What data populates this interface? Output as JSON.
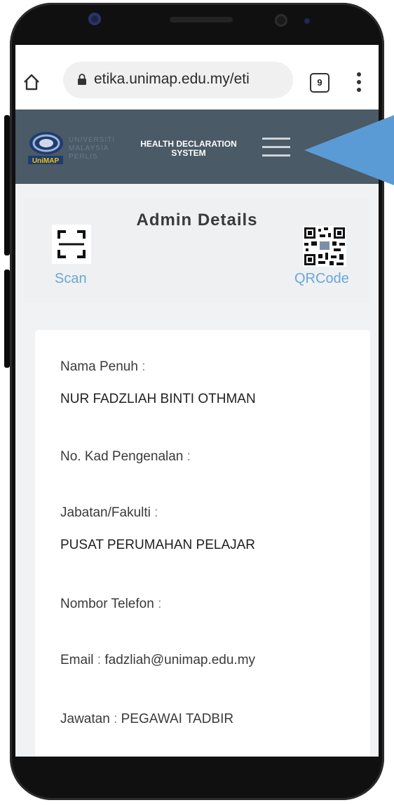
{
  "browser": {
    "url": "etika.unimap.edu.my/eti",
    "tab_count": "9"
  },
  "header": {
    "logo_text_lines": [
      "UNIVERSITI",
      "MALAYSIA",
      "PERLIS"
    ],
    "system_title_line1": "HEALTH DECLARATION",
    "system_title_line2": "SYSTEM"
  },
  "admin": {
    "title": "Admin Details",
    "scan_label": "Scan",
    "qrcode_label": "QRCode"
  },
  "details": {
    "full_name_label": "Nama Penuh",
    "full_name_value": "NUR FADZLIAH BINTI OTHMAN",
    "ic_label": "No. Kad Pengenalan",
    "dept_label": "Jabatan/Fakulti",
    "dept_value": "PUSAT PERUMAHAN PELAJAR",
    "phone_label": "Nombor Telefon",
    "email_label": "Email",
    "email_value": "fadzliah@unimap.edu.my",
    "position_label": "Jawatan",
    "position_value": "PEGAWAI TADBIR",
    "separator": ":"
  },
  "colors": {
    "header_bg": "#4a5a66",
    "link_blue": "#6aa7d8",
    "arrow_blue": "#5b9bd5"
  },
  "icons": [
    "home-icon",
    "lock-icon",
    "tabs-icon",
    "more-vert-icon",
    "unimap-logo",
    "hamburger-menu-icon",
    "scan-icon",
    "qr-code-icon",
    "pointer-arrow-icon"
  ]
}
